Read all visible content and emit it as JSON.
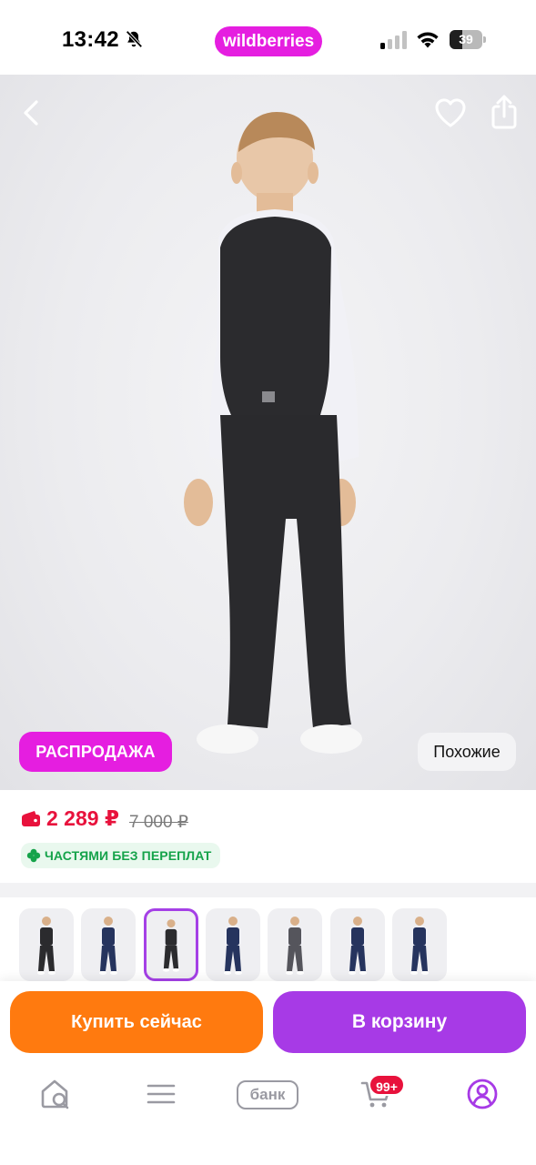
{
  "status_bar": {
    "time": "13:42",
    "brand": "wildberries",
    "battery": "39",
    "battery_level": 0.39
  },
  "product": {
    "sale_badge": "РАСПРОДАЖА",
    "similar_label": "Похожие",
    "price": "2 289 ₽",
    "old_price": "7 000 ₽",
    "installment": "ЧАСТЯМИ БЕЗ ПЕРЕПЛАТ",
    "thumbnails": [
      {
        "suit": "black",
        "selected": false
      },
      {
        "suit": "navy",
        "selected": false
      },
      {
        "suit": "black",
        "selected": true
      },
      {
        "suit": "navy",
        "selected": false
      },
      {
        "suit": "grey",
        "selected": false
      },
      {
        "suit": "navy",
        "selected": false
      },
      {
        "suit": "navy",
        "selected": false
      }
    ]
  },
  "actions": {
    "buy_now": "Купить сейчас",
    "add_to_cart": "В корзину"
  },
  "nav": {
    "bank": "банк",
    "cart_badge": "99+",
    "items": [
      "home-search-icon",
      "menu-icon",
      "bank",
      "cart-icon",
      "profile-icon"
    ]
  },
  "colors": {
    "brand": "#e51ee0",
    "price": "#e8123c",
    "buy_now": "#ff7a0f",
    "cart": "#a73ae6",
    "installment": "#15a34a"
  }
}
